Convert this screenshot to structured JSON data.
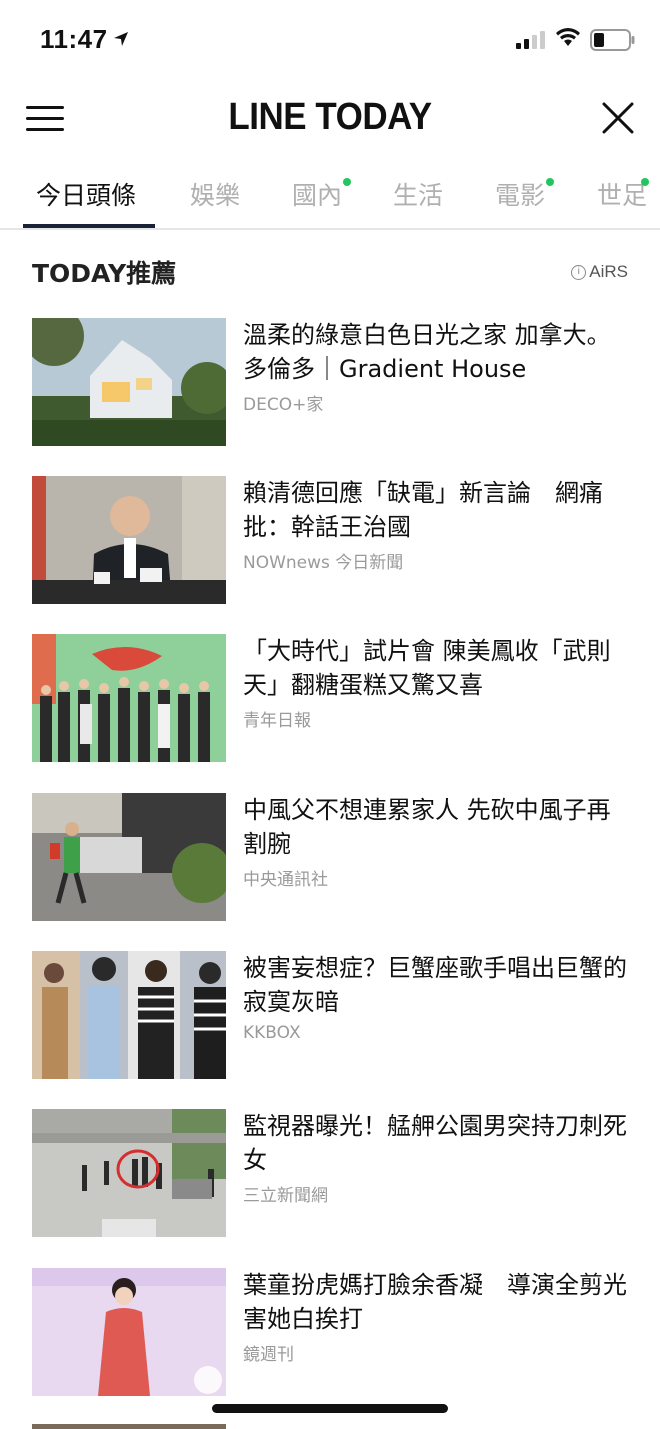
{
  "status_bar": {
    "time": "11:47"
  },
  "header": {
    "brand": "LINE TODAY"
  },
  "tabs": [
    {
      "label": "今日頭條",
      "active": true,
      "dot": false
    },
    {
      "label": "娛樂",
      "active": false,
      "dot": false
    },
    {
      "label": "國內",
      "active": false,
      "dot": true
    },
    {
      "label": "生活",
      "active": false,
      "dot": false
    },
    {
      "label": "電影",
      "active": false,
      "dot": true
    },
    {
      "label": "世足",
      "active": false,
      "dot": true
    }
  ],
  "section": {
    "title": "TODAY推薦",
    "airs_label": "AiRS"
  },
  "articles": [
    {
      "title": "溫柔的綠意白色日光之家 加拿大。多倫多｜Gradient House",
      "source": "DECO+家"
    },
    {
      "title": "賴清德回應「缺電」新言論　網痛批：幹話王治國",
      "source": "NOWnews 今日新聞"
    },
    {
      "title": "「大時代」試片會 陳美鳳收「武則天」翻糖蛋糕又驚又喜",
      "source": "青年日報"
    },
    {
      "title": "中風父不想連累家人 先砍中風子再割腕",
      "source": "中央通訊社"
    },
    {
      "title": "被害妄想症？巨蟹座歌手唱出巨蟹的寂寞灰暗",
      "source": "KKBOX"
    },
    {
      "title": "監視器曝光！艋舺公園男突持刀刺死女",
      "source": "三立新聞網"
    },
    {
      "title": "葉童扮虎媽打臉余香凝　導演全剪光害她白挨打",
      "source": "鏡週刊"
    }
  ],
  "colors": {
    "accent_underline": "#1a2235",
    "dot": "#22c55e",
    "muted": "#9a9a9a"
  }
}
